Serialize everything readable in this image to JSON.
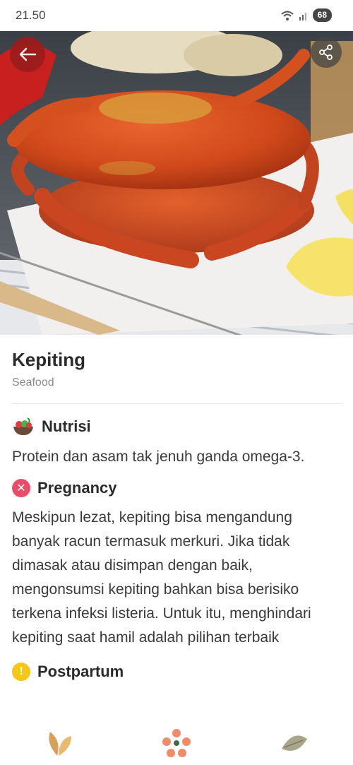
{
  "status": {
    "time": "21.50",
    "battery": "68",
    "wifi_icon": "wifi-icon",
    "signal_icon": "signal-icon"
  },
  "header": {
    "back_icon": "arrow-left-icon",
    "share_icon": "share-icon"
  },
  "food": {
    "name": "Kepiting",
    "category": "Seafood"
  },
  "nutrisi": {
    "title": "Nutrisi",
    "text": "Protein dan asam tak jenuh ganda omega-3."
  },
  "pregnancy": {
    "title": "Pregnancy",
    "status": "not-recommended",
    "text": "Meskipun lezat, kepiting bisa mengandung banyak racun termasuk merkuri. Jika tidak dimasak atau disimpan dengan baik, mengonsumsi kepiting bahkan bisa berisiko terkena infeksi listeria. Untuk itu, menghindari kepiting saat hamil adalah pilihan terbaik"
  },
  "postpartum": {
    "title": "Postpartum",
    "status": "caution"
  },
  "colors": {
    "accent_red": "#e84d69",
    "warning_yellow": "#f5c518",
    "back_button": "#9c1c1c"
  },
  "nav": [
    "leaves-icon",
    "flower-icon",
    "leaf-icon"
  ]
}
